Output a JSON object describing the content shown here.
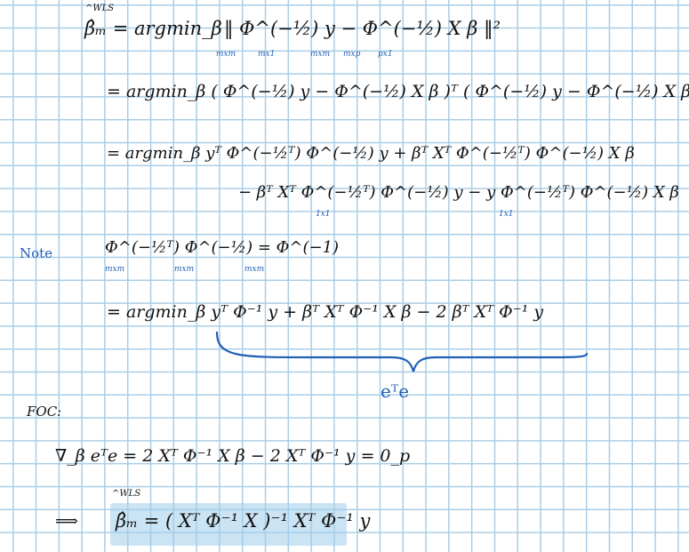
{
  "notebook": {
    "line1_label": "β̂ₘ = argmin_β",
    "line1_expr": "‖ Φ^(−½) y − Φ^(−½) X β ‖²",
    "line1_hat": "^WLS",
    "dims_line1": [
      "mxm",
      "mx1",
      "mxm",
      "mxp",
      "px1"
    ],
    "line2": "= argmin_β  ( Φ^(−½) y − Φ^(−½) X β )ᵀ ( Φ^(−½) y − Φ^(−½) X β )",
    "line3": "= argmin_β   yᵀ Φ^(−½ᵀ) Φ^(−½) y  +  βᵀ Xᵀ Φ^(−½ᵀ) Φ^(−½) X β",
    "line4": "− βᵀ Xᵀ Φ^(−½ᵀ) Φ^(−½) y  −  y Φ^(−½ᵀ) Φ^(−½) X β",
    "dims_line4": [
      "1x1",
      "1x1"
    ],
    "note_label": "Note",
    "note_expr": "Φ^(−½ᵀ) Φ^(−½) = Φ^(−1)",
    "dims_note": [
      "mxm",
      "mxm",
      "mxm"
    ],
    "line5": "= argmin_β   yᵀ Φ⁻¹ y  +  βᵀ Xᵀ Φ⁻¹ X β  −  2 βᵀ Xᵀ Φ⁻¹ y",
    "brace_label": "eᵀe",
    "foc_label": "FOC:",
    "foc_expr": "∇_β eᵀe  = 2 Xᵀ Φ⁻¹ X β  −  2 Xᵀ Φ⁻¹ y   =  0_p",
    "result_arrow": "⟹",
    "result_expr": "β̂ₘ = ( Xᵀ Φ⁻¹ X )⁻¹ Xᵀ Φ⁻¹ y",
    "result_hat": "^WLS"
  },
  "colors": {
    "ink": "#111111",
    "blue_ink": "#1f5fb5",
    "grid": "#a9cde6",
    "highlight": "#a0cdeb"
  }
}
